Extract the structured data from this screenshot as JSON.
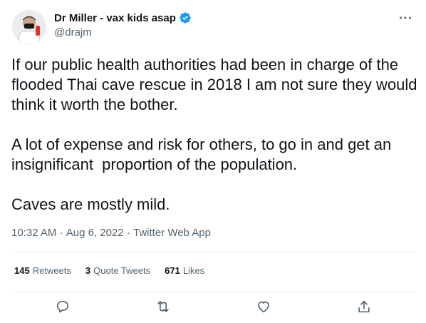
{
  "author": {
    "display_name": "Dr Miller - vax kids asap",
    "handle": "@drajm",
    "verified": true,
    "verified_color": "#1d9bf0",
    "avatar_icon": "avatar-photo"
  },
  "tweet": {
    "paragraphs": [
      "If our public health authorities had been in charge of the flooded Thai cave rescue in 2018 I am not sure they would think it worth the bother.",
      "A lot of expense and risk for others, to go in and get an insignificant  proportion of the population.",
      "Caves are mostly mild."
    ],
    "time": "10:32 AM",
    "date": "Aug 6, 2022",
    "source": "Twitter Web App",
    "separator": "·"
  },
  "stats": {
    "retweets_count": "145",
    "retweets_label": "Retweets",
    "quotes_count": "3",
    "quotes_label": "Quote Tweets",
    "likes_count": "671",
    "likes_label": "Likes"
  },
  "actions": {
    "reply_icon": "reply-icon",
    "retweet_icon": "retweet-icon",
    "like_icon": "like-icon",
    "share_icon": "share-icon"
  },
  "colors": {
    "text": "#0f1419",
    "secondary": "#536471",
    "divider": "#eff3f4",
    "accent": "#1d9bf0"
  }
}
